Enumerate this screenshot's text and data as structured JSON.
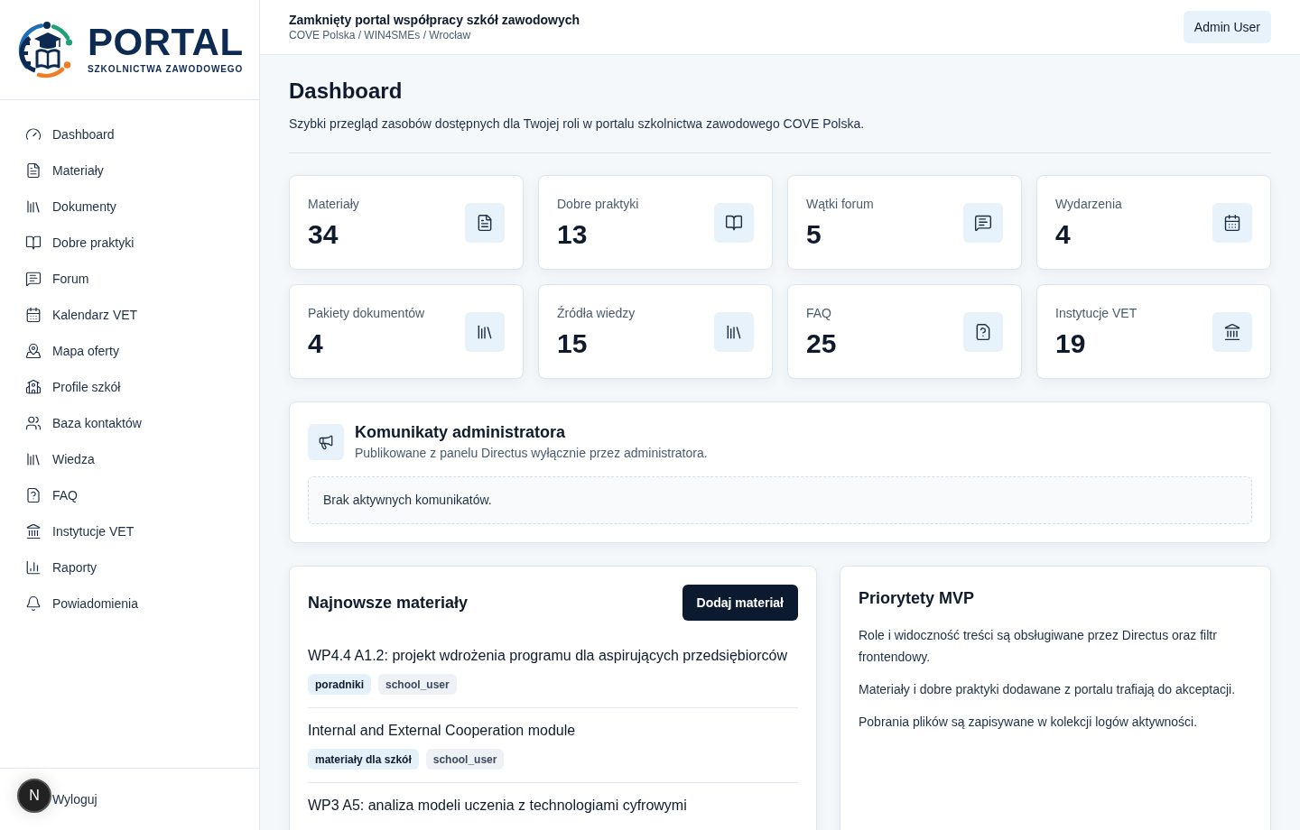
{
  "sidebar": {
    "logo": {
      "title": "PORTAL",
      "subtitle": "SZKOLNICTWA ZAWODOWEGO"
    },
    "items": [
      "Dashboard",
      "Materiały",
      "Dokumenty",
      "Dobre praktyki",
      "Forum",
      "Kalendarz VET",
      "Mapa oferty",
      "Profile szkół",
      "Baza kontaktów",
      "Wiedza",
      "FAQ",
      "Instytucje VET",
      "Raporty",
      "Powiadomienia"
    ],
    "logout": "Wyloguj"
  },
  "header": {
    "title": "Zamknięty portal współpracy szkół zawodowych",
    "breadcrumb": "COVE Polska / WIN4SMEs / Wrocław",
    "user_button": "Admin User"
  },
  "page": {
    "title": "Dashboard",
    "description": "Szybki przegląd zasobów dostępnych dla Twojej roli w portalu szkolnictwa zawodowego COVE Polska."
  },
  "stats": [
    {
      "label": "Materiały",
      "value": "34"
    },
    {
      "label": "Dobre praktyki",
      "value": "13"
    },
    {
      "label": "Wątki forum",
      "value": "5"
    },
    {
      "label": "Wydarzenia",
      "value": "4"
    },
    {
      "label": "Pakiety dokumentów",
      "value": "4"
    },
    {
      "label": "Źródła wiedzy",
      "value": "15"
    },
    {
      "label": "FAQ",
      "value": "25"
    },
    {
      "label": "Instytucje VET",
      "value": "19"
    }
  ],
  "announcements": {
    "title": "Komunikaty administratora",
    "subtitle": "Publikowane z panelu Directus wyłącznie przez administratora.",
    "empty_message": "Brak aktywnych komunikatów."
  },
  "latest_materials": {
    "title": "Najnowsze materiały",
    "add_button": "Dodaj materiał",
    "items": [
      {
        "title": "WP4.4 A1.2: projekt wdrożenia programu dla aspirujących przedsiębiorców",
        "tags": [
          {
            "label": "poradniki",
            "kind": "category"
          },
          {
            "label": "school_user",
            "kind": "role"
          }
        ]
      },
      {
        "title": "Internal and External Cooperation module",
        "tags": [
          {
            "label": "materiały dla szkół",
            "kind": "category"
          },
          {
            "label": "school_user",
            "kind": "role"
          }
        ]
      },
      {
        "title": "WP3 A5: analiza modeli uczenia z technologiami cyfrowymi"
      }
    ]
  },
  "priorities": {
    "title": "Priorytety MVP",
    "paragraphs": [
      "Role i widoczność treści są obsługiwane przez Directus oraz filtr frontendowy.",
      "Materiały i dobre praktyki dodawane z portalu trafiają do akceptacji.",
      "Pobrania plików są zapisywane w kolekcji logów aktywności."
    ]
  },
  "dev_badge": {
    "label": "N"
  }
}
